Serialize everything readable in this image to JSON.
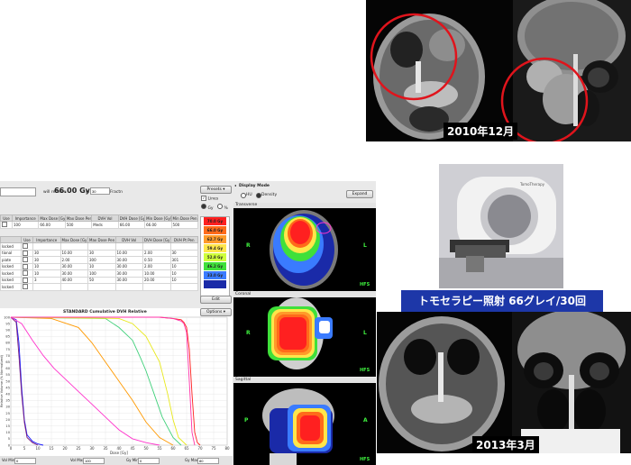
{
  "ct_top": {
    "date": "2010年12月"
  },
  "ct_bottom": {
    "date": "2013年3月"
  },
  "banner": {
    "text": "トモセラピー照射  66グレイ/30回"
  },
  "app": {
    "receive_prefix": "will receive",
    "dose": "66.00 Gy",
    "in_label": "in",
    "fractions_value": "30",
    "fractions_label": "Fractn",
    "presets_label": "Presets",
    "lines_label": "Lines",
    "gy_label": "Gy",
    "pct_label": "%",
    "edit_label": "Edit",
    "display_mode_label": "Display Mode",
    "hu_label": "HU",
    "density_label": "Density",
    "expand_label": "Expand",
    "options_label": "Options",
    "dvh_title": "STANDARD Cumulative DVH Relative",
    "x_axis_label": "Dose [Gy]",
    "y_axis_label": "Relative Volume (% Normalized)",
    "views": {
      "transverse": "Transverse",
      "coronal": "Coronal",
      "sagittal": "Sagittal"
    },
    "orient": {
      "R": "R",
      "L": "L",
      "P": "P",
      "A": "A",
      "HFS": "HFS"
    },
    "target_table": {
      "headers": [
        "Use",
        "Importance",
        "Max Dose [Gy]",
        "Max Dose Pen",
        "DVH Vol",
        "DVH Dose [Gy]",
        "Min Dose [Gy]",
        "Min Dose Pen"
      ],
      "row": [
        "",
        "100",
        "66.00",
        "500",
        "Meds",
        "66.00",
        "66.00",
        "500"
      ]
    },
    "oar_table": {
      "headers": [
        "",
        "Use",
        "Importance",
        "Max Dose [Gy]",
        "Max Dose Pen",
        "DVH Vol",
        "DVH Dose [Gy]",
        "DVH Pt Pen"
      ],
      "rows": [
        [
          "locked",
          "",
          "",
          "",
          "",
          "",
          "",
          ""
        ],
        [
          "tional",
          "",
          "30",
          "10.00",
          "30",
          "10.00",
          "2.00",
          "30"
        ],
        [
          "piate",
          "",
          "30",
          "2.00",
          "300",
          "30.00",
          "0.50",
          "301"
        ],
        [
          "locked",
          "",
          "10",
          "30.00",
          "10",
          "30.00",
          "2.00",
          "10"
        ],
        [
          "locked",
          "",
          "10",
          "30.00",
          "100",
          "30.00",
          "10.00",
          "10"
        ],
        [
          "locked",
          "",
          "3",
          "40.00",
          "50",
          "30.00",
          "20.00",
          "10"
        ],
        [
          "locked",
          "",
          "",
          "",
          "",
          "",
          "",
          ""
        ]
      ]
    },
    "isodose": [
      {
        "label": "70.0 Gy",
        "color": "#ff2020"
      },
      {
        "label": "66.0 Gy",
        "color": "#ff6a1a"
      },
      {
        "label": "62.7 Gy",
        "color": "#ff9a2a"
      },
      {
        "label": "59.4 Gy",
        "color": "#ffe64a"
      },
      {
        "label": "52.8 Gy",
        "color": "#cfff3a"
      },
      {
        "label": "46.2 Gy",
        "color": "#3fe03a"
      },
      {
        "label": "33.0 Gy",
        "color": "#3a7bff"
      },
      {
        "label": "",
        "color": "#1a2aa8"
      }
    ],
    "footer": {
      "vol_min_label": "Vol Min:",
      "vol_min": "0",
      "vol_max_label": "Vol Max:",
      "vol_max": "100",
      "gy_min_label": "Gy Min:",
      "gy_min": "0",
      "gy_max_label": "Gy Max:",
      "gy_max": "80"
    }
  },
  "machine": {
    "brand": "TomoTherapy"
  },
  "chart_data": {
    "type": "line",
    "title": "STANDARD Cumulative DVH Relative",
    "xlabel": "Dose [Gy]",
    "ylabel": "Relative Volume (% Normalized)",
    "xlim": [
      0,
      80
    ],
    "ylim": [
      0,
      100
    ],
    "x_ticks": [
      0,
      5,
      10,
      15,
      20,
      25,
      30,
      35,
      40,
      45,
      50,
      55,
      60,
      65,
      70,
      75,
      80
    ],
    "y_ticks": [
      0,
      5,
      10,
      15,
      20,
      25,
      30,
      35,
      40,
      45,
      50,
      55,
      60,
      65,
      70,
      75,
      80,
      85,
      90,
      95,
      100
    ],
    "series": [
      {
        "color": "#1a1aff",
        "x": [
          0,
          2,
          3,
          4,
          5,
          6,
          8,
          10,
          12
        ],
        "y": [
          100,
          98,
          80,
          45,
          20,
          8,
          3,
          1,
          0
        ]
      },
      {
        "color": "#7a1a7a",
        "x": [
          0,
          2,
          3,
          4,
          5,
          6,
          8,
          10
        ],
        "y": [
          100,
          96,
          70,
          40,
          18,
          6,
          2,
          0
        ]
      },
      {
        "color": "#ff33cc",
        "x": [
          0,
          4,
          8,
          12,
          16,
          20,
          25,
          30,
          35,
          40,
          45,
          50,
          55
        ],
        "y": [
          100,
          95,
          82,
          70,
          60,
          52,
          42,
          32,
          22,
          12,
          5,
          2,
          0
        ]
      },
      {
        "color": "#ff9900",
        "x": [
          0,
          15,
          25,
          30,
          35,
          40,
          45,
          50,
          55,
          60
        ],
        "y": [
          100,
          99,
          92,
          80,
          65,
          50,
          35,
          18,
          6,
          0
        ]
      },
      {
        "color": "#3fd07a",
        "x": [
          0,
          35,
          40,
          45,
          48,
          50,
          53,
          56,
          60,
          63
        ],
        "y": [
          100,
          99,
          92,
          82,
          68,
          58,
          40,
          22,
          6,
          0
        ]
      },
      {
        "color": "#e8e81a",
        "x": [
          0,
          40,
          45,
          50,
          55,
          58,
          60,
          62,
          65
        ],
        "y": [
          100,
          99,
          95,
          85,
          65,
          40,
          20,
          6,
          0
        ]
      },
      {
        "color": "#ff2020",
        "x": [
          0,
          55,
          60,
          63,
          64,
          65,
          66,
          67,
          68,
          69,
          70
        ],
        "y": [
          100,
          100,
          99,
          98,
          96,
          92,
          75,
          40,
          10,
          2,
          0
        ]
      },
      {
        "color": "#ff33aa",
        "x": [
          0,
          55,
          60,
          63,
          64,
          65,
          66,
          67,
          68
        ],
        "y": [
          100,
          100,
          99,
          97,
          95,
          88,
          50,
          10,
          0
        ]
      }
    ]
  }
}
